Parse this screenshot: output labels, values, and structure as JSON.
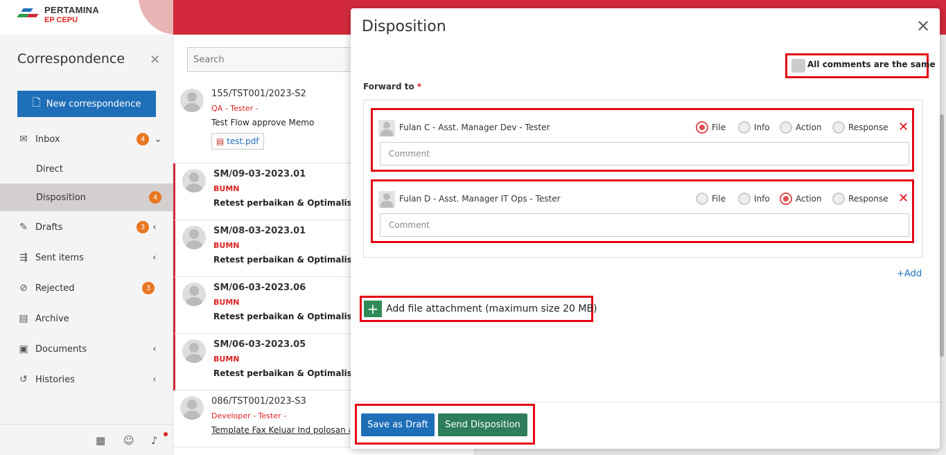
{
  "brand": {
    "name": "PERTAMINA",
    "sub": "EP CEPU"
  },
  "sidebar": {
    "title": "Correspondence",
    "new_button": "New correspondence",
    "items": [
      {
        "label": "Inbox",
        "badge": "4"
      },
      {
        "label": "Direct"
      },
      {
        "label": "Disposition",
        "badge": "4"
      },
      {
        "label": "Drafts",
        "badge": "3"
      },
      {
        "label": "Sent items"
      },
      {
        "label": "Rejected",
        "badge": "3"
      },
      {
        "label": "Archive"
      },
      {
        "label": "Documents"
      },
      {
        "label": "Histories"
      }
    ]
  },
  "search": {
    "placeholder": "Search"
  },
  "list": [
    {
      "no": "155/TST001/2023-S2",
      "from": "QA - Tester -",
      "subject": "Test Flow approve Memo",
      "attachment": "test.pdf"
    },
    {
      "no": "SM/09-03-2023.01",
      "from": "BUMN",
      "subject": "Retest perbaikan & Optimalisasi issue"
    },
    {
      "no": "SM/08-03-2023.01",
      "from": "BUMN",
      "subject": "Retest perbaikan & Optimalisasi issue"
    },
    {
      "no": "SM/06-03-2023.06",
      "from": "BUMN",
      "subject": "Retest perbaikan & Optimalisasi issue"
    },
    {
      "no": "SM/06-03-2023.05",
      "from": "BUMN",
      "subject": "Retest perbaikan & Optimalisasi issue"
    },
    {
      "no": "086/TST001/2023-S3",
      "from": "Developer - Tester -",
      "subject": "Template Fax Keluar Ind polosan app"
    }
  ],
  "modal": {
    "title": "Disposition",
    "same_comments": "All comments are the same",
    "forward_label": "Forward to",
    "required_mark": "*",
    "radio_labels": [
      "File",
      "Info",
      "Action",
      "Response"
    ],
    "recipients": [
      {
        "name": "Fulan C - Asst. Manager Dev - Tester",
        "selected": "File",
        "comment_placeholder": "Comment"
      },
      {
        "name": "Fulan D - Asst. Manager IT Ops - Tester",
        "selected": "Action",
        "comment_placeholder": "Comment"
      }
    ],
    "add_label": "Add",
    "attach_label": "Add file attachment (maximum size 20 MB)",
    "save_draft": "Save as Draft",
    "send": "Send Disposition"
  }
}
